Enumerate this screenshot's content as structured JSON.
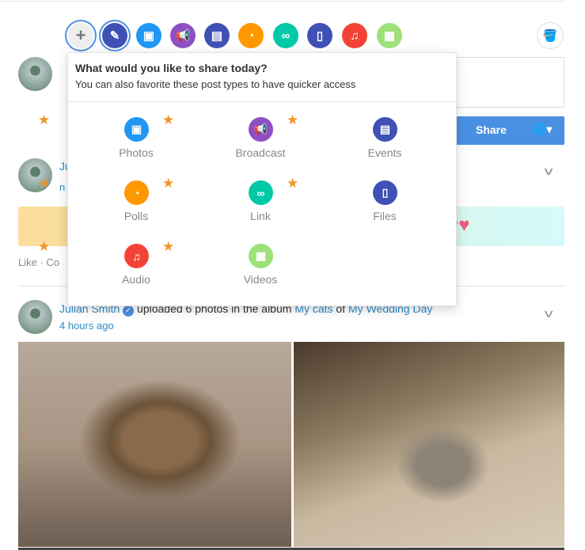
{
  "toolbar": {
    "buttons": [
      {
        "icon": "plus-icon",
        "color": "#eeeeee"
      },
      {
        "icon": "pencil-icon",
        "color": "#3f51b5"
      },
      {
        "icon": "image-icon",
        "color": "#2196f3"
      },
      {
        "icon": "megaphone-icon",
        "color": "#8e4fc4"
      },
      {
        "icon": "calendar-icon",
        "color": "#3f51b5"
      },
      {
        "icon": "pie-chart-icon",
        "color": "#ff9800"
      },
      {
        "icon": "link-icon",
        "color": "#00c9a7"
      },
      {
        "icon": "file-icon",
        "color": "#3f51b5"
      },
      {
        "icon": "music-icon",
        "color": "#f44336"
      },
      {
        "icon": "film-icon",
        "color": "#9ee07a"
      }
    ]
  },
  "popup": {
    "title": "What would you like to share today?",
    "subtitle": "You can also favorite these post types to have quicker access",
    "items": [
      {
        "label": "Photos",
        "icon": "image-icon",
        "color": "#2196f3"
      },
      {
        "label": "Broadcast",
        "icon": "megaphone-icon",
        "color": "#8e4fc4"
      },
      {
        "label": "Events",
        "icon": "calendar-icon",
        "color": "#3f51b5"
      },
      {
        "label": "Polls",
        "icon": "pie-chart-icon",
        "color": "#ff9800"
      },
      {
        "label": "Link",
        "icon": "link-icon",
        "color": "#00c9a7"
      },
      {
        "label": "Files",
        "icon": "file-icon",
        "color": "#3f51b5"
      },
      {
        "label": "Audio",
        "icon": "music-icon",
        "color": "#f44336"
      },
      {
        "label": "Videos",
        "icon": "film-icon",
        "color": "#9ee07a"
      }
    ]
  },
  "composer": {
    "share_label": "Share"
  },
  "post1": {
    "name_partial": "Ju",
    "sub_partial": "n",
    "actions_partial": "Like · Co"
  },
  "post2": {
    "name": "Julian Smith",
    "text1": " uploaded 6 photos in the album ",
    "album": "My cats",
    "text2": " of ",
    "event": "My Wedding Day",
    "time": "4 hours ago"
  }
}
